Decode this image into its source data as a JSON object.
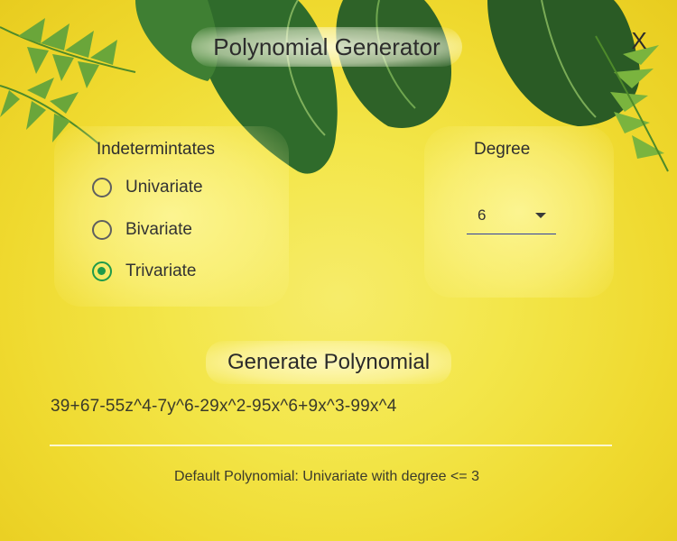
{
  "window": {
    "title": "Polynomial Generator",
    "close_label": "X"
  },
  "indeterminates": {
    "label": "Indetermintates",
    "options": [
      {
        "label": "Univariate",
        "checked": false
      },
      {
        "label": "Bivariate",
        "checked": false
      },
      {
        "label": "Trivariate",
        "checked": true
      }
    ]
  },
  "degree": {
    "label": "Degree",
    "selected": "6"
  },
  "generate_label": "Generate Polynomial",
  "polynomial": "39+67-55z^4-7y^6-29x^2-95x^6+9x^3-99x^4",
  "footer_note": "Default Polynomial: Univariate with degree <= 3",
  "colors": {
    "accent": "#1f9a4a",
    "select_underline": "#2f3fa0",
    "background": "#f3e64a"
  }
}
